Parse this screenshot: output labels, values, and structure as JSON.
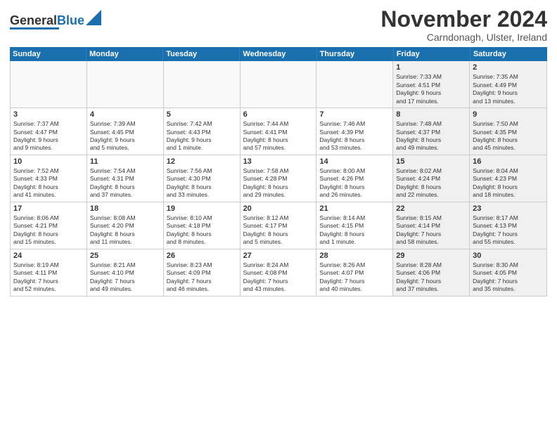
{
  "logo": {
    "part1": "General",
    "part2": "Blue"
  },
  "title": "November 2024",
  "location": "Carndonagh, Ulster, Ireland",
  "weekdays": [
    "Sunday",
    "Monday",
    "Tuesday",
    "Wednesday",
    "Thursday",
    "Friday",
    "Saturday"
  ],
  "rows": [
    [
      {
        "day": "",
        "empty": true,
        "lines": []
      },
      {
        "day": "",
        "empty": true,
        "lines": []
      },
      {
        "day": "",
        "empty": true,
        "lines": []
      },
      {
        "day": "",
        "empty": true,
        "lines": []
      },
      {
        "day": "",
        "empty": true,
        "lines": []
      },
      {
        "day": "1",
        "shaded": true,
        "lines": [
          "Sunrise: 7:33 AM",
          "Sunset: 4:51 PM",
          "Daylight: 9 hours",
          "and 17 minutes."
        ]
      },
      {
        "day": "2",
        "shaded": true,
        "lines": [
          "Sunrise: 7:35 AM",
          "Sunset: 4:49 PM",
          "Daylight: 9 hours",
          "and 13 minutes."
        ]
      }
    ],
    [
      {
        "day": "3",
        "lines": [
          "Sunrise: 7:37 AM",
          "Sunset: 4:47 PM",
          "Daylight: 9 hours",
          "and 9 minutes."
        ]
      },
      {
        "day": "4",
        "lines": [
          "Sunrise: 7:39 AM",
          "Sunset: 4:45 PM",
          "Daylight: 9 hours",
          "and 5 minutes."
        ]
      },
      {
        "day": "5",
        "lines": [
          "Sunrise: 7:42 AM",
          "Sunset: 4:43 PM",
          "Daylight: 9 hours",
          "and 1 minute."
        ]
      },
      {
        "day": "6",
        "lines": [
          "Sunrise: 7:44 AM",
          "Sunset: 4:41 PM",
          "Daylight: 8 hours",
          "and 57 minutes."
        ]
      },
      {
        "day": "7",
        "lines": [
          "Sunrise: 7:46 AM",
          "Sunset: 4:39 PM",
          "Daylight: 8 hours",
          "and 53 minutes."
        ]
      },
      {
        "day": "8",
        "shaded": true,
        "lines": [
          "Sunrise: 7:48 AM",
          "Sunset: 4:37 PM",
          "Daylight: 8 hours",
          "and 49 minutes."
        ]
      },
      {
        "day": "9",
        "shaded": true,
        "lines": [
          "Sunrise: 7:50 AM",
          "Sunset: 4:35 PM",
          "Daylight: 8 hours",
          "and 45 minutes."
        ]
      }
    ],
    [
      {
        "day": "10",
        "lines": [
          "Sunrise: 7:52 AM",
          "Sunset: 4:33 PM",
          "Daylight: 8 hours",
          "and 41 minutes."
        ]
      },
      {
        "day": "11",
        "lines": [
          "Sunrise: 7:54 AM",
          "Sunset: 4:31 PM",
          "Daylight: 8 hours",
          "and 37 minutes."
        ]
      },
      {
        "day": "12",
        "lines": [
          "Sunrise: 7:56 AM",
          "Sunset: 4:30 PM",
          "Daylight: 8 hours",
          "and 33 minutes."
        ]
      },
      {
        "day": "13",
        "lines": [
          "Sunrise: 7:58 AM",
          "Sunset: 4:28 PM",
          "Daylight: 8 hours",
          "and 29 minutes."
        ]
      },
      {
        "day": "14",
        "lines": [
          "Sunrise: 8:00 AM",
          "Sunset: 4:26 PM",
          "Daylight: 8 hours",
          "and 26 minutes."
        ]
      },
      {
        "day": "15",
        "shaded": true,
        "lines": [
          "Sunrise: 8:02 AM",
          "Sunset: 4:24 PM",
          "Daylight: 8 hours",
          "and 22 minutes."
        ]
      },
      {
        "day": "16",
        "shaded": true,
        "lines": [
          "Sunrise: 8:04 AM",
          "Sunset: 4:23 PM",
          "Daylight: 8 hours",
          "and 18 minutes."
        ]
      }
    ],
    [
      {
        "day": "17",
        "lines": [
          "Sunrise: 8:06 AM",
          "Sunset: 4:21 PM",
          "Daylight: 8 hours",
          "and 15 minutes."
        ]
      },
      {
        "day": "18",
        "lines": [
          "Sunrise: 8:08 AM",
          "Sunset: 4:20 PM",
          "Daylight: 8 hours",
          "and 11 minutes."
        ]
      },
      {
        "day": "19",
        "lines": [
          "Sunrise: 8:10 AM",
          "Sunset: 4:18 PM",
          "Daylight: 8 hours",
          "and 8 minutes."
        ]
      },
      {
        "day": "20",
        "lines": [
          "Sunrise: 8:12 AM",
          "Sunset: 4:17 PM",
          "Daylight: 8 hours",
          "and 5 minutes."
        ]
      },
      {
        "day": "21",
        "lines": [
          "Sunrise: 8:14 AM",
          "Sunset: 4:15 PM",
          "Daylight: 8 hours",
          "and 1 minute."
        ]
      },
      {
        "day": "22",
        "shaded": true,
        "lines": [
          "Sunrise: 8:15 AM",
          "Sunset: 4:14 PM",
          "Daylight: 7 hours",
          "and 58 minutes."
        ]
      },
      {
        "day": "23",
        "shaded": true,
        "lines": [
          "Sunrise: 8:17 AM",
          "Sunset: 4:13 PM",
          "Daylight: 7 hours",
          "and 55 minutes."
        ]
      }
    ],
    [
      {
        "day": "24",
        "lines": [
          "Sunrise: 8:19 AM",
          "Sunset: 4:11 PM",
          "Daylight: 7 hours",
          "and 52 minutes."
        ]
      },
      {
        "day": "25",
        "lines": [
          "Sunrise: 8:21 AM",
          "Sunset: 4:10 PM",
          "Daylight: 7 hours",
          "and 49 minutes."
        ]
      },
      {
        "day": "26",
        "lines": [
          "Sunrise: 8:23 AM",
          "Sunset: 4:09 PM",
          "Daylight: 7 hours",
          "and 46 minutes."
        ]
      },
      {
        "day": "27",
        "lines": [
          "Sunrise: 8:24 AM",
          "Sunset: 4:08 PM",
          "Daylight: 7 hours",
          "and 43 minutes."
        ]
      },
      {
        "day": "28",
        "lines": [
          "Sunrise: 8:26 AM",
          "Sunset: 4:07 PM",
          "Daylight: 7 hours",
          "and 40 minutes."
        ]
      },
      {
        "day": "29",
        "shaded": true,
        "lines": [
          "Sunrise: 8:28 AM",
          "Sunset: 4:06 PM",
          "Daylight: 7 hours",
          "and 37 minutes."
        ]
      },
      {
        "day": "30",
        "shaded": true,
        "lines": [
          "Sunrise: 8:30 AM",
          "Sunset: 4:05 PM",
          "Daylight: 7 hours",
          "and 35 minutes."
        ]
      }
    ]
  ]
}
